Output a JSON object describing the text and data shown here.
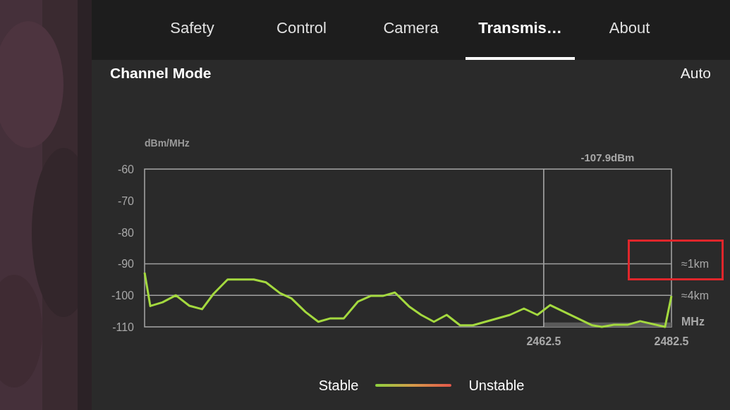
{
  "tabs": [
    {
      "label": "Safety",
      "selected": false
    },
    {
      "label": "Control",
      "selected": false
    },
    {
      "label": "Camera",
      "selected": false
    },
    {
      "label": "Transmis…",
      "selected": true
    },
    {
      "label": "About",
      "selected": false
    }
  ],
  "channel_mode": {
    "label": "Channel Mode",
    "value": "Auto"
  },
  "spectrum": {
    "highlight_box": true,
    "chart_data": {
      "type": "line",
      "ylabel": "dBm/MHz",
      "xlabel": "MHz",
      "xlim": [
        2400,
        2482.5
      ],
      "ylim": [
        -110,
        -60
      ],
      "yticks": [
        -60,
        -70,
        -80,
        -90,
        -100,
        -110
      ],
      "xticks": [
        2462.5,
        2482.5
      ],
      "x": [
        2400,
        2400.9,
        2402.8,
        2404.9,
        2407,
        2409,
        2410.8,
        2413,
        2417.1,
        2419,
        2421.2,
        2423,
        2425.2,
        2427.2,
        2429.1,
        2431.2,
        2433.4,
        2435.4,
        2437.3,
        2439.2,
        2441.4,
        2443.3,
        2445.3,
        2447.3,
        2449.4,
        2451.4,
        2457.2,
        2459.4,
        2461.5,
        2463.5,
        2470.1,
        2471.6,
        2473.5,
        2475.7,
        2477.6,
        2481.5,
        2482.5
      ],
      "series": [
        {
          "color": "#a4d93f",
          "values": [
            -92.8,
            -103.4,
            -102.2,
            -100,
            -103.3,
            -104.4,
            -99.5,
            -95,
            -95,
            -95.9,
            -99.3,
            -101,
            -105.3,
            -108.4,
            -107.3,
            -107.3,
            -102,
            -100.2,
            -100.2,
            -99.1,
            -103.5,
            -106.2,
            -108.4,
            -106.2,
            -109.5,
            -109.5,
            -106.2,
            -104.2,
            -106.2,
            -103.1,
            -109.5,
            -110,
            -109.3,
            -109.3,
            -108.2,
            -110,
            -100.2
          ]
        }
      ],
      "annotations": [
        "-107.9dBm"
      ],
      "ref_lines": [
        {
          "axis": "x",
          "value": 2462.5
        },
        {
          "axis": "y",
          "value": -90,
          "label": "≈1km"
        },
        {
          "axis": "y",
          "value": -100,
          "label": "≈4km"
        }
      ]
    }
  },
  "legend": {
    "stable": "Stable",
    "unstable": "Unstable"
  }
}
